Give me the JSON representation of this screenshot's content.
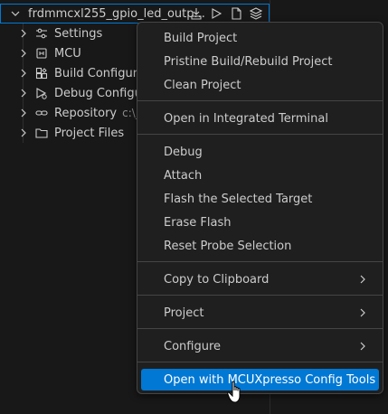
{
  "tree": {
    "root": {
      "label": "frdmmcxl255_gpio_led_outp..."
    },
    "items": [
      {
        "label": "Settings",
        "icon": "settings-sliders-icon"
      },
      {
        "label": "MCU",
        "icon": "chip-icon"
      },
      {
        "label": "Build Configurati",
        "icon": "build-config-icon"
      },
      {
        "label": "Debug Configur",
        "icon": "debug-config-icon"
      },
      {
        "label": "Repository",
        "description": "c:\\_D",
        "icon": "link-icon"
      },
      {
        "label": "Project Files",
        "icon": "folder-icon"
      }
    ]
  },
  "context_menu": {
    "groups": [
      [
        "Build Project",
        "Pristine Build/Rebuild Project",
        "Clean Project"
      ],
      [
        "Open in Integrated Terminal"
      ],
      [
        "Debug",
        "Attach",
        "Flash the Selected Target",
        "Erase Flash",
        "Reset Probe Selection"
      ],
      [
        "Copy to Clipboard"
      ],
      [
        "Project"
      ],
      [
        "Configure"
      ],
      [
        "Open with MCUXpresso Config Tools"
      ]
    ],
    "items": {
      "build_project": "Build Project",
      "pristine_build": "Pristine Build/Rebuild Project",
      "clean_project": "Clean Project",
      "open_terminal": "Open in Integrated Terminal",
      "debug": "Debug",
      "attach": "Attach",
      "flash_target": "Flash the Selected Target",
      "erase_flash": "Erase Flash",
      "reset_probe": "Reset Probe Selection",
      "copy_clipboard": "Copy to Clipboard",
      "project": "Project",
      "configure": "Configure",
      "open_config_tools": "Open with MCUXpresso Config Tools"
    },
    "submenus": [
      "Copy to Clipboard",
      "Project",
      "Configure"
    ],
    "highlighted": "Open with MCUXpresso Config Tools"
  },
  "colors": {
    "accent": "#0078d4",
    "menu_bg": "#1f1f1f",
    "sidebar_bg": "#181818",
    "text": "#cccccc"
  }
}
